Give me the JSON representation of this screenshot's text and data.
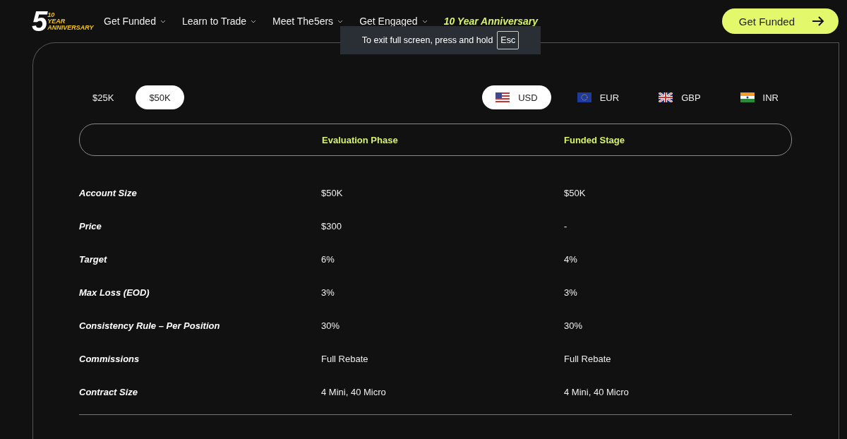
{
  "header": {
    "logo": {
      "number": "5",
      "line_1": "10",
      "line_2": "YEAR",
      "line_3": "ANNIVERSARY"
    },
    "nav": [
      {
        "label": "Get Funded",
        "kind": "dropdown"
      },
      {
        "label": "Learn to Trade",
        "kind": "dropdown"
      },
      {
        "label": "Meet The5ers",
        "kind": "dropdown"
      },
      {
        "label": "Get Engaged",
        "kind": "dropdown"
      },
      {
        "label": "10 Year Anniversary",
        "kind": "highlight"
      }
    ],
    "cta": "Get Funded"
  },
  "fullscreen_notice": {
    "text": "To exit full screen, press and hold",
    "key": "Esc"
  },
  "account_sizes": [
    {
      "label": "$25K",
      "selected": false
    },
    {
      "label": "$50K",
      "selected": true
    }
  ],
  "currencies": [
    {
      "label": "USD",
      "kind": "us",
      "selected": true
    },
    {
      "label": "EUR",
      "kind": "eu",
      "selected": false
    },
    {
      "label": "GBP",
      "kind": "gb",
      "selected": false
    },
    {
      "label": "INR",
      "kind": "in",
      "selected": false
    }
  ],
  "table": {
    "columns": [
      "Evaluation Phase",
      "Funded Stage"
    ],
    "rows": [
      {
        "label": "Account Size",
        "values": [
          "$50K",
          "$50K"
        ]
      },
      {
        "label": "Price",
        "values": [
          "$300",
          "-"
        ]
      },
      {
        "label": "Target",
        "values": [
          "6%",
          "4%"
        ]
      },
      {
        "label": "Max Loss (EOD)",
        "values": [
          "3%",
          "3%"
        ]
      },
      {
        "label": "Consistency Rule – Per Position",
        "values": [
          "30%",
          "30%"
        ]
      },
      {
        "label": "Commissions",
        "values": [
          "Full Rebate",
          "Full Rebate"
        ]
      },
      {
        "label": "Contract Size",
        "values": [
          "4 Mini, 40 Micro",
          "4 Mini, 40 Micro"
        ]
      }
    ]
  }
}
